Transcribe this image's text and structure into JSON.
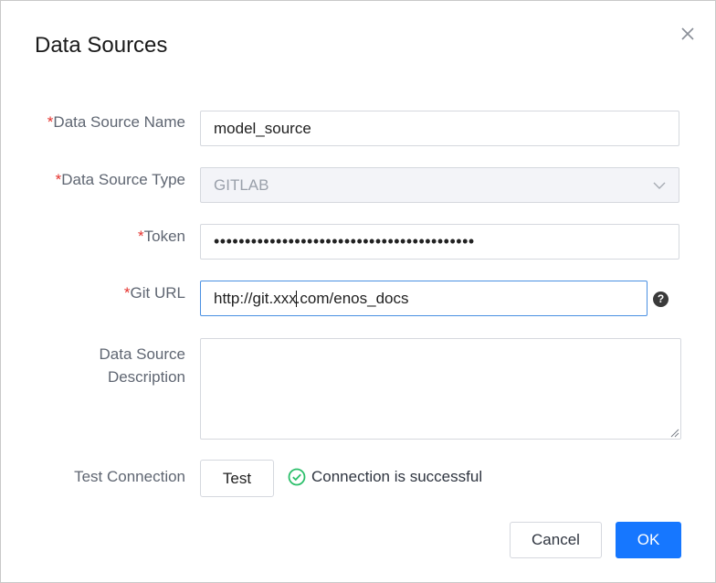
{
  "dialog": {
    "title": "Data Sources",
    "close_icon": "close-icon"
  },
  "form": {
    "required_mark": "*",
    "name": {
      "label": "Data Source Name",
      "value": "model_source"
    },
    "type": {
      "label": "Data Source Type",
      "value": "GITLAB",
      "icon": "chevron-down-icon"
    },
    "token": {
      "label": "Token",
      "value": "••••••••••••••••••••••••••••••••••••••••••"
    },
    "git_url": {
      "label": "Git URL",
      "value_before_cursor": "http://git.xxx",
      "value_after_cursor": ".com/enos_docs",
      "help": "?"
    },
    "description": {
      "label_line1": "Data Source",
      "label_line2": "Description",
      "value": ""
    },
    "test": {
      "label": "Test Connection",
      "button": "Test",
      "status": "Connection is successful",
      "status_icon": "check-circle-icon"
    }
  },
  "footer": {
    "cancel": "Cancel",
    "ok": "OK"
  },
  "colors": {
    "primary": "#1677ff",
    "required": "#e5322d",
    "success": "#2bbf6a"
  }
}
